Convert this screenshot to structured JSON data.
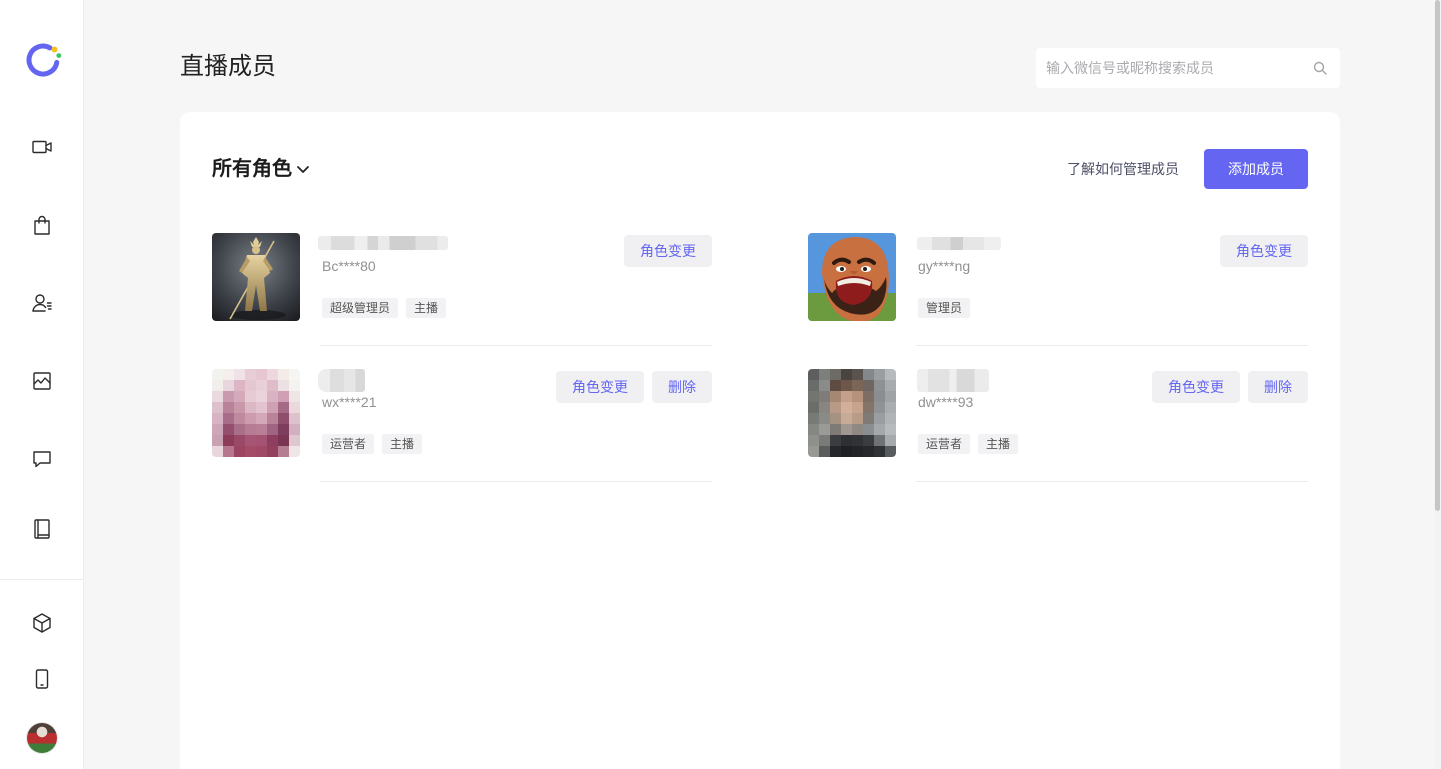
{
  "colors": {
    "accent": "#6466f1"
  },
  "sidebar": {
    "logo_icon": "app-logo-icon",
    "nav_top": [
      {
        "icon": "video-camera-icon"
      },
      {
        "icon": "shopping-bag-icon"
      },
      {
        "icon": "user-list-icon"
      },
      {
        "icon": "image-chart-icon"
      },
      {
        "icon": "chat-bubble-icon"
      },
      {
        "icon": "book-icon"
      }
    ],
    "nav_bottom": [
      {
        "icon": "cube-icon"
      },
      {
        "icon": "phone-icon"
      },
      {
        "icon": "user-avatar-icon"
      }
    ]
  },
  "header": {
    "title": "直播成员",
    "search_placeholder": "输入微信号或昵称搜索成员",
    "search_icon": "search-icon"
  },
  "toolbar": {
    "role_filter": "所有角色",
    "role_filter_icon": "chevron-down-icon",
    "help_link": "了解如何管理成员",
    "add_button": "添加成员"
  },
  "members": [
    {
      "account": "Bc****80",
      "tags": [
        "超级管理员",
        "主播"
      ],
      "actions": [
        "角色变更"
      ]
    },
    {
      "account": "gy****ng",
      "tags": [
        "管理员"
      ],
      "actions": [
        "角色变更"
      ]
    },
    {
      "account": "wx****21",
      "tags": [
        "运营者",
        "主播"
      ],
      "actions": [
        "角色变更",
        "删除"
      ]
    },
    {
      "account": "dw****93",
      "tags": [
        "运营者",
        "主播"
      ],
      "actions": [
        "角色变更",
        "删除"
      ]
    }
  ]
}
